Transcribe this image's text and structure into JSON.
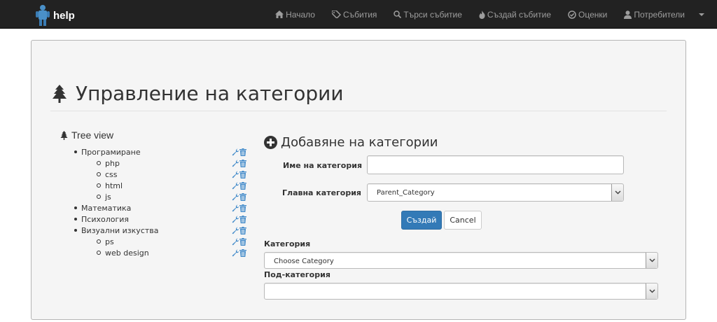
{
  "navbar": {
    "brand": "help",
    "items": [
      {
        "label": "Начало",
        "icon": "home-icon"
      },
      {
        "label": "Събития",
        "icon": "tags-icon"
      },
      {
        "label": "Търси събитие",
        "icon": "search-icon"
      },
      {
        "label": "Създай събитие",
        "icon": "fire-icon"
      },
      {
        "label": "Оценки",
        "icon": "check-circle-icon"
      },
      {
        "label": "Потребители",
        "icon": "user-icon"
      }
    ],
    "dropdown_icon": "caret-down-icon"
  },
  "page": {
    "title": "Управление на категории",
    "title_icon": "tree-icon"
  },
  "tree": {
    "title": "Tree view",
    "items": [
      {
        "label": "Програмиране",
        "level": 1
      },
      {
        "label": "php",
        "level": 2
      },
      {
        "label": "css",
        "level": 2
      },
      {
        "label": "html",
        "level": 2
      },
      {
        "label": "js",
        "level": 2
      },
      {
        "label": "Математика",
        "level": 1
      },
      {
        "label": "Психология",
        "level": 1
      },
      {
        "label": "Визуални изкуства",
        "level": 1
      },
      {
        "label": "ps",
        "level": 2
      },
      {
        "label": "web design",
        "level": 2
      }
    ],
    "row_icons": [
      "wrench-icon",
      "trash-icon"
    ]
  },
  "form": {
    "title": "Добавяне на категории",
    "title_icon": "plus-circle-icon",
    "name_label": "Име на категория",
    "name_value": "",
    "parent_label": "Главна категория",
    "parent_value": "Parent_Category",
    "create_button": "Създай",
    "cancel_button": "Cancel",
    "category_label": "Категория",
    "category_value": "Choose Category",
    "subcategory_label": "Под-категория",
    "subcategory_value": ""
  },
  "colors": {
    "navbar_bg": "#222222",
    "panel_bg": "#f5f5f5",
    "primary": "#337ab7",
    "icon_blue": "#428bca"
  }
}
